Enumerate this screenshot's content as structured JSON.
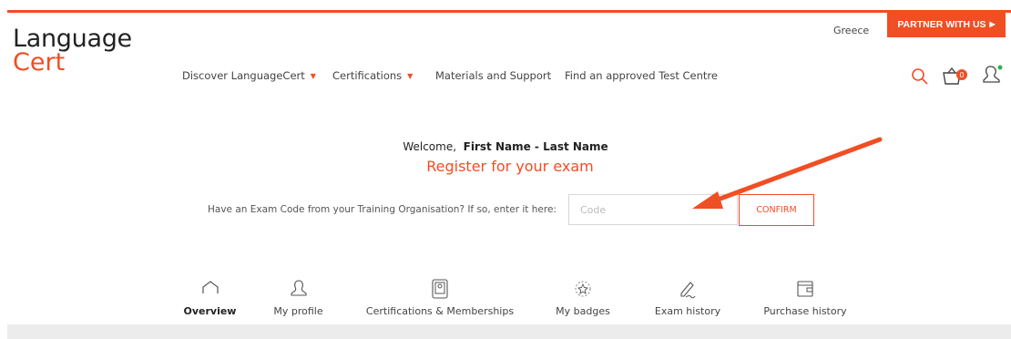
{
  "header": {
    "logo_line1": "Language",
    "logo_line2": "Cert",
    "country": "Greece",
    "partner_label": "PARTNER WITH US",
    "cart_count": "0"
  },
  "nav": {
    "items": [
      {
        "label": "Discover LanguageCert",
        "has_dropdown": true
      },
      {
        "label": "Certifications",
        "has_dropdown": true
      },
      {
        "label": "Materials and Support",
        "has_dropdown": false
      },
      {
        "label": "Find an approved Test Centre",
        "has_dropdown": false
      }
    ]
  },
  "main": {
    "welcome_prefix": "Welcome,",
    "user_name": "First Name - Last Name",
    "register_title": "Register for your exam",
    "code_prompt": "Have an Exam Code from your Training Organisation? If so, enter it here:",
    "code_placeholder": "Code",
    "code_value": "",
    "confirm_label": "CONFIRM"
  },
  "tabs": [
    {
      "label": "Overview",
      "icon": "home-icon",
      "active": true
    },
    {
      "label": "My profile",
      "icon": "user-icon",
      "active": false
    },
    {
      "label": "Certifications & Memberships",
      "icon": "certificate-icon",
      "active": false
    },
    {
      "label": "My badges",
      "icon": "badge-icon",
      "active": false
    },
    {
      "label": "Exam history",
      "icon": "pen-icon",
      "active": false
    },
    {
      "label": "Purchase history",
      "icon": "wallet-icon",
      "active": false
    }
  ],
  "colors": {
    "accent": "#f04e23",
    "online_dot": "#2bb24c",
    "tab_bar_bg": "#ececec"
  }
}
